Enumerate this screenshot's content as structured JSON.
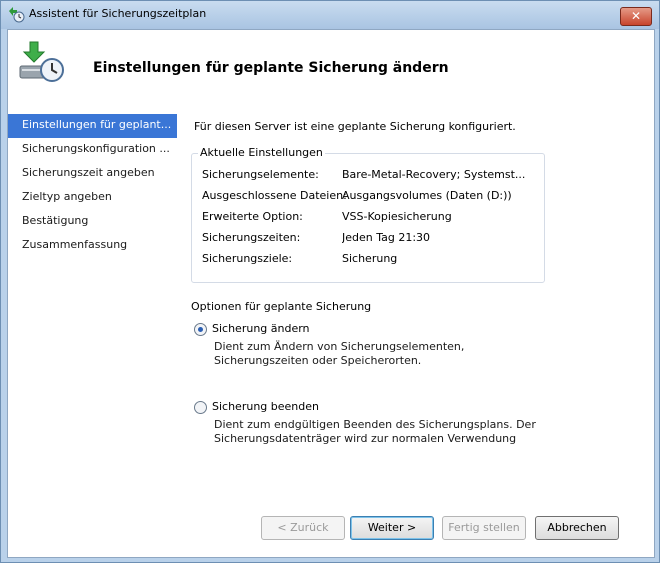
{
  "window": {
    "title": "Assistent für Sicherungszeitplan",
    "close_glyph": "✕"
  },
  "header": {
    "title": "Einstellungen für geplante Sicherung ändern"
  },
  "nav": {
    "items": [
      {
        "label": "Einstellungen für geplant..."
      },
      {
        "label": "Sicherungskonfiguration ..."
      },
      {
        "label": "Sicherungszeit angeben"
      },
      {
        "label": "Zieltyp angeben"
      },
      {
        "label": "Bestätigung"
      },
      {
        "label": "Zusammenfassung"
      }
    ],
    "active_index": 0
  },
  "content": {
    "intro": "Für diesen Server ist eine geplante Sicherung konfiguriert.",
    "current_settings": {
      "legend": "Aktuelle Einstellungen",
      "rows": [
        {
          "key": "Sicherungselemente:",
          "value": "Bare-Metal-Recovery; Systemst..."
        },
        {
          "key": "Ausgeschlossene Dateien:",
          "value": "Ausgangsvolumes (Daten (D:))"
        },
        {
          "key": "Erweiterte Option:",
          "value": "VSS-Kopiesicherung"
        },
        {
          "key": "Sicherungszeiten:",
          "value": "Jeden Tag 21:30"
        },
        {
          "key": "Sicherungsziele:",
          "value": "Sicherung"
        }
      ]
    },
    "options": {
      "title": "Optionen für geplante Sicherung",
      "items": [
        {
          "label": "Sicherung ändern",
          "description": "Dient zum Ändern von Sicherungselementen, Sicherungszeiten oder Speicherorten.",
          "selected": true
        },
        {
          "label": "Sicherung beenden",
          "description": "Dient zum endgültigen Beenden des Sicherungsplans. Der Sicherungsdatenträger wird zur normalen Verwendung",
          "selected": false
        }
      ]
    }
  },
  "buttons": {
    "back": "< Zurück",
    "next": "Weiter >",
    "finish": "Fertig stellen",
    "cancel": "Abbrechen"
  },
  "colors": {
    "accent": "#3a76d6",
    "close": "#c8442c"
  }
}
